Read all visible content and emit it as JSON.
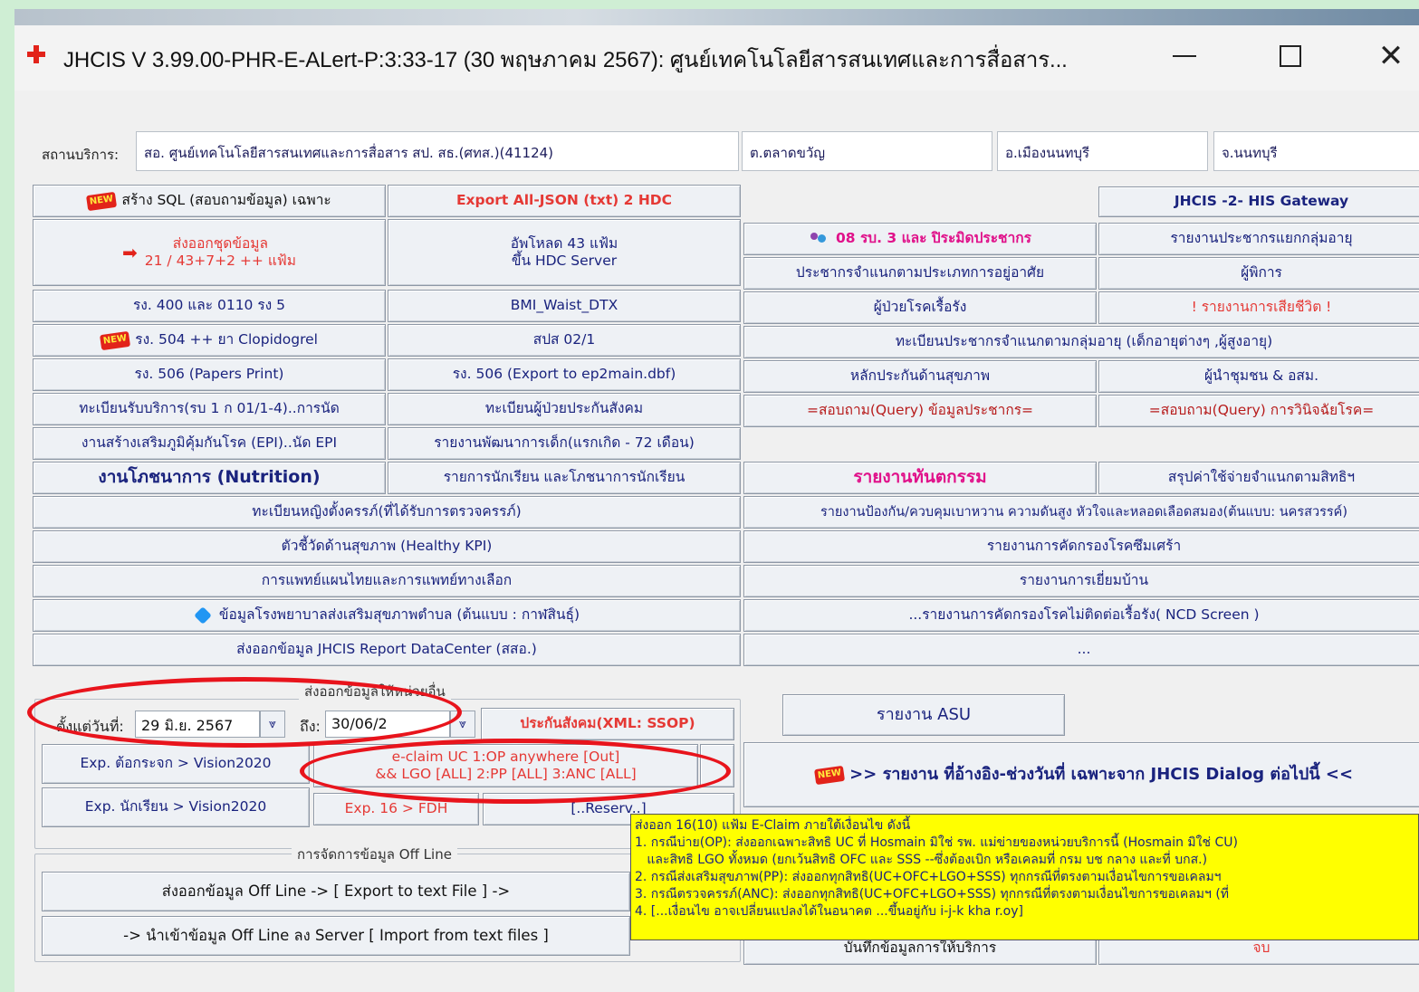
{
  "window": {
    "title": "JHCIS V 3.99.00-PHR-E-ALert-P:3:33-17 (30 พฤษภาคม 2567): ศูนย์เทคโนโลยีสารสนเทศและการสื่อสาร...",
    "minimize": "—",
    "maximize": "☐",
    "close": "✕"
  },
  "service": {
    "label": "สถานบริการ:",
    "name": "สอ. ศูนย์เทคโนโลยีสารสนเทศและการสื่อสาร สป. สธ.(ศทส.)(41124)",
    "subdistrict": "ต.ตลาดขวัญ",
    "district": "อ.เมืองนนทบุรี",
    "province": "จ.นนทบุรี"
  },
  "new_badge": "NEW",
  "left_buttons": {
    "sql": "สร้าง SQL (สอบถามข้อมูล) เฉพาะ",
    "export_json": "Export All-JSON (txt) 2 HDC",
    "export_line1": "ส่งออกชุดข้อมูล",
    "export_line2": "21 / 43+7+2 ++ แฟ้ม",
    "upload_line1": "อัพโหลด 43 แฟ้ม",
    "upload_line2": "ขึ้น HDC Server",
    "r400": "รง. 400 และ 0110 รง 5",
    "bmi": "BMI_Waist_DTX",
    "r504": "รง. 504 ++ ยา Clopidogrel",
    "spo": "สปส 02/1",
    "r506_print": "รง. 506 (Papers Print)",
    "r506_export": "รง. 506 (Export to ep2main.dbf)",
    "service_reg": "ทะเบียนรับบริการ(รบ 1 ก 01/1-4)..การนัด",
    "social_reg": "ทะเบียนผู้ป่วยประกันสังคม",
    "epi": "งานสร้างเสริมภูมิคุ้มกันโรค (EPI)..นัด EPI",
    "child_dev": "รายงานพัฒนาการเด็ก(แรกเกิด - 72 เดือน)",
    "nutrition": "งานโภชนาการ (Nutrition)",
    "students": "รายการนักเรียน และโภชนาการนักเรียน",
    "pregnant": "ทะเบียนหญิงตั้งครรภ์(ที่ได้รับการตรวจครรภ์)",
    "kpi": "ตัวชี้วัดด้านสุขภาพ  (Healthy KPI)",
    "thai_med": "การแพทย์แผนไทยและการแพทย์ทางเลือก",
    "hospital_data": "ข้อมูลโรงพยาบาลส่งเสริมสุขภาพตำบล (ต้นแบบ : กาฬสินธุ์)",
    "datacenter": "ส่งออกข้อมูล JHCIS Report DataCenter (สสอ.)"
  },
  "right_buttons": {
    "gateway": "JHCIS -2- HIS Gateway",
    "r08": "08 รบ. 3 และ ปิระมิดประชากร",
    "pop_age": "รายงานประชากรแยกกลุ่มอายุ",
    "pop_type": "ประชากรจำแนกตามประเภทการอยู่อาศัย",
    "disabled": "ผู้พิการ",
    "chronic": "ผู้ป่วยโรคเรื้อรัง",
    "death": "! รายงานการเสียชีวิต !",
    "pop_reg": "ทะเบียนประชากรจำแนกตามกลุ่มอายุ (เด็กอายุต่างๆ ,ผู้สูงอายุ)",
    "insurance": "หลักประกันด้านสุขภาพ",
    "leaders": "ผู้นำชุมชน & อสม.",
    "query_pop": "=สอบถาม(Query) ข้อมูลประชากร=",
    "query_diag": "=สอบถาม(Query) การวินิจฉัยโรค=",
    "dental": "รายงานทันตกรรม",
    "cost": "สรุปค่าใช้จ่ายจำแนกตามสิทธิฯ",
    "ncd_prevent": "รายงานป้องกัน/ควบคุมเบาหวาน ความดันสูง หัวใจและหลอดเลือดสมอง(ต้นแบบ: นครสวรรค์)",
    "depression": "รายงานการคัดกรองโรคซึมเศร้า",
    "home_visit": "รายงานการเยี่ยมบ้าน",
    "ncd_screen": "...รายงานการคัดกรองโรคไม่ติดต่อเรื้อรัง( NCD Screen )",
    "more": "...",
    "asu": "รายงาน ASU",
    "referral": ">> รายงาน ที่อ้างอิง-ช่วงวันที่ เฉพาะจาก JHCIS Dialog ต่อไปนี้ <<",
    "service_record": "บันทึกข้อมูลการให้บริการ",
    "finish": "จบ"
  },
  "export_group": {
    "title": "ส่งออกข้อมูลให้หน่วยอื่น",
    "from_label": "ตั้งแต่วันที่:",
    "from_value": "29 มิ.ย. 2567",
    "to_label": "ถึง:",
    "to_value": "30/06/2",
    "ssop": "ประกันสังคม(XML: SSOP)",
    "vision_glass": "Exp. ต้อกระจก > Vision2020",
    "eclaim_line1": "e-claim UC 1:OP anywhere [Out]",
    "eclaim_line2": "&& LGO [ALL] 2:PP [ALL] 3:ANC [ALL]",
    "vision_student": "Exp. นักเรียน > Vision2020",
    "exp16": "Exp. 16 > FDH",
    "reserv": "[..Reserv..]"
  },
  "offline_group": {
    "title": "การจัดการข้อมูล Off Line",
    "export": "ส่งออกข้อมูล Off Line -> [ Export to text File ] ->",
    "import": "-> นำเข้าข้อมูล Off Line ลง Server [ Import from text files ]"
  },
  "tooltip": {
    "lines": [
      "ส่งออก 16(10) แฟ้ม E-Claim ภายใต้เงื่อนไข ดังนี้",
      "1. กรณีบ่าย(OP): ส่งออกเฉพาะสิทธิ UC ที่ Hosmain มิใช่ รพ. แม่ข่ายของหน่วยบริการนี้ (Hosmain มิใช่ CU)",
      "   และสิทธิ LGO ทั้งหมด (ยกเว้นสิทธิ OFC และ SSS --ซึ่งต้องเบิก หรือเคลมที่ กรม บช กลาง และที่ บกส.)",
      "2. กรณีส่งเสริมสุขภาพ(PP): ส่งออกทุกสิทธิ(UC+OFC+LGO+SSS) ทุกกรณีที่ตรงตามเงื่อนไขการขอเคลมฯ",
      "3. กรณีตรวจครรภ์(ANC): ส่งออกทุกสิทธิ(UC+OFC+LGO+SSS) ทุกกรณีที่ตรงตามเงื่อนไขการขอเคลมฯ (ที่",
      "4. [...เงื่อนไข อาจเปลี่ยนแปลงได้ในอนาคต ...ขึ้นอยู่กับ i-j-k kha r.oy]"
    ]
  },
  "colors": {
    "annotation": "#e8141c",
    "tooltip_bg": "#ffff00",
    "button_text": "#1a237e",
    "red_text": "#e53935",
    "magenta_text": "#e0118a",
    "background": "#cfeed4"
  },
  "icons": [
    "app-cross-icon",
    "new-badge-icon",
    "red-arrow-icon",
    "people-icon",
    "puzzle-icon",
    "dropdown-arrow-icon"
  ]
}
